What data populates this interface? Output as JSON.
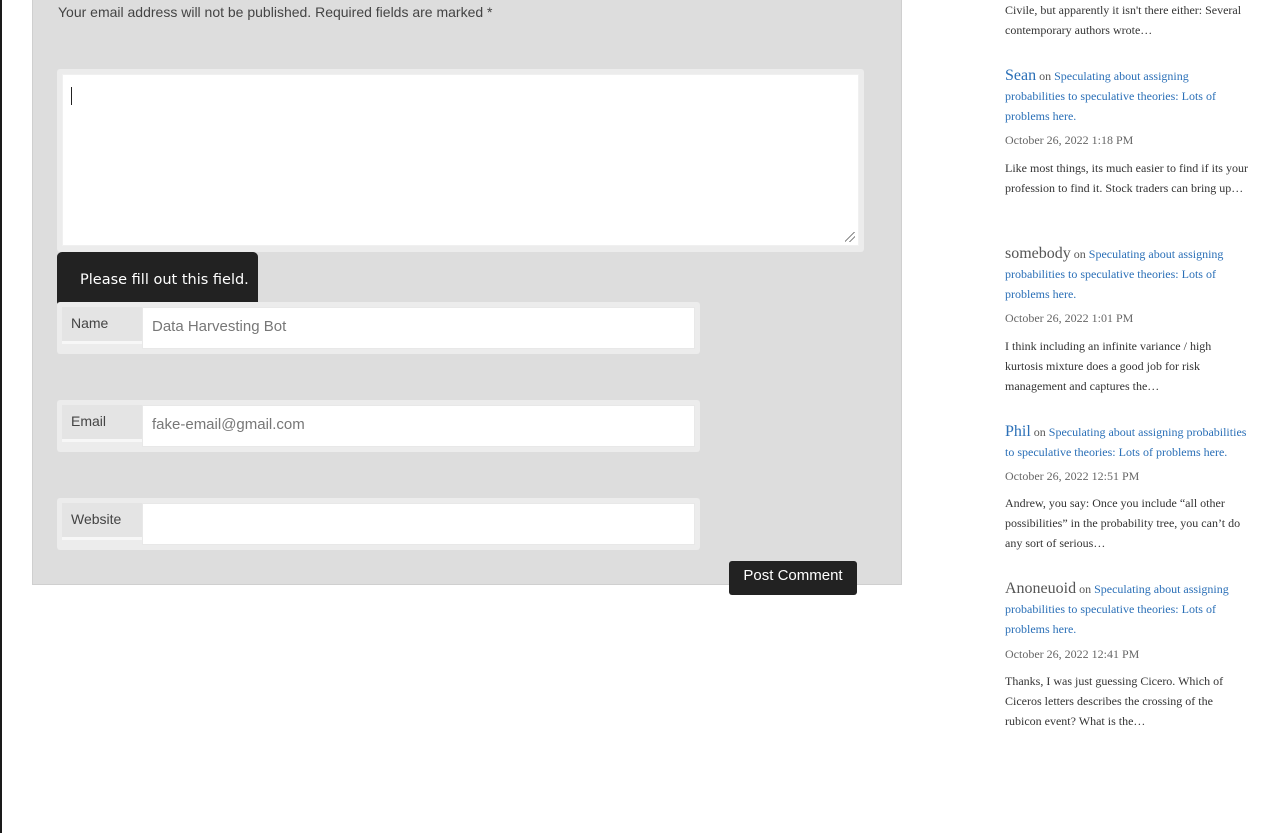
{
  "comment_form": {
    "notice": "Your email address will not be published. Required fields are marked *",
    "comment_value": "",
    "validation_tooltip": "Please fill out this field.",
    "fields": {
      "name": {
        "label": "Name",
        "value": "Data Harvesting Bot"
      },
      "email": {
        "label": "Email",
        "value": "fake-email@gmail.com"
      },
      "website": {
        "label": "Website",
        "value": ""
      }
    },
    "submit_label": "Post Comment"
  },
  "recent_comments": {
    "top_excerpt": "Civile, but apparently it isn't there either: Several contemporary authors wrote…",
    "items": [
      {
        "author": "Sean",
        "author_linked": true,
        "on": "on",
        "post": "Speculating about assigning probabilities to speculative theories: Lots of problems here.",
        "date": "October 26, 2022 1:18 PM",
        "excerpt": "Like most things, its much easier to find if its your profession to find it. Stock traders can bring up…"
      },
      {
        "author": "somebody",
        "author_linked": false,
        "on": "on",
        "post": "Speculating about assigning probabilities to speculative theories: Lots of problems here.",
        "date": "October 26, 2022 1:01 PM",
        "excerpt": "I think including an infinite variance / high kurtosis mixture does a good job for risk management and captures the…"
      },
      {
        "author": "Phil",
        "author_linked": true,
        "on": "on",
        "post": "Speculating about assigning probabilities to speculative theories: Lots of problems here.",
        "date": "October 26, 2022 12:51 PM",
        "excerpt": "Andrew, you say: Once you include “all other possibilities” in the probability tree, you can’t do any sort of serious…"
      },
      {
        "author": "Anoneuoid",
        "author_linked": false,
        "on": "on",
        "post": "Speculating about assigning probabilities to speculative theories: Lots of problems here.",
        "date": "October 26, 2022 12:41 PM",
        "excerpt": "Thanks, I was just guessing Cicero. Which of Ciceros letters describes the crossing of the rubicon event? What is the…"
      }
    ]
  }
}
